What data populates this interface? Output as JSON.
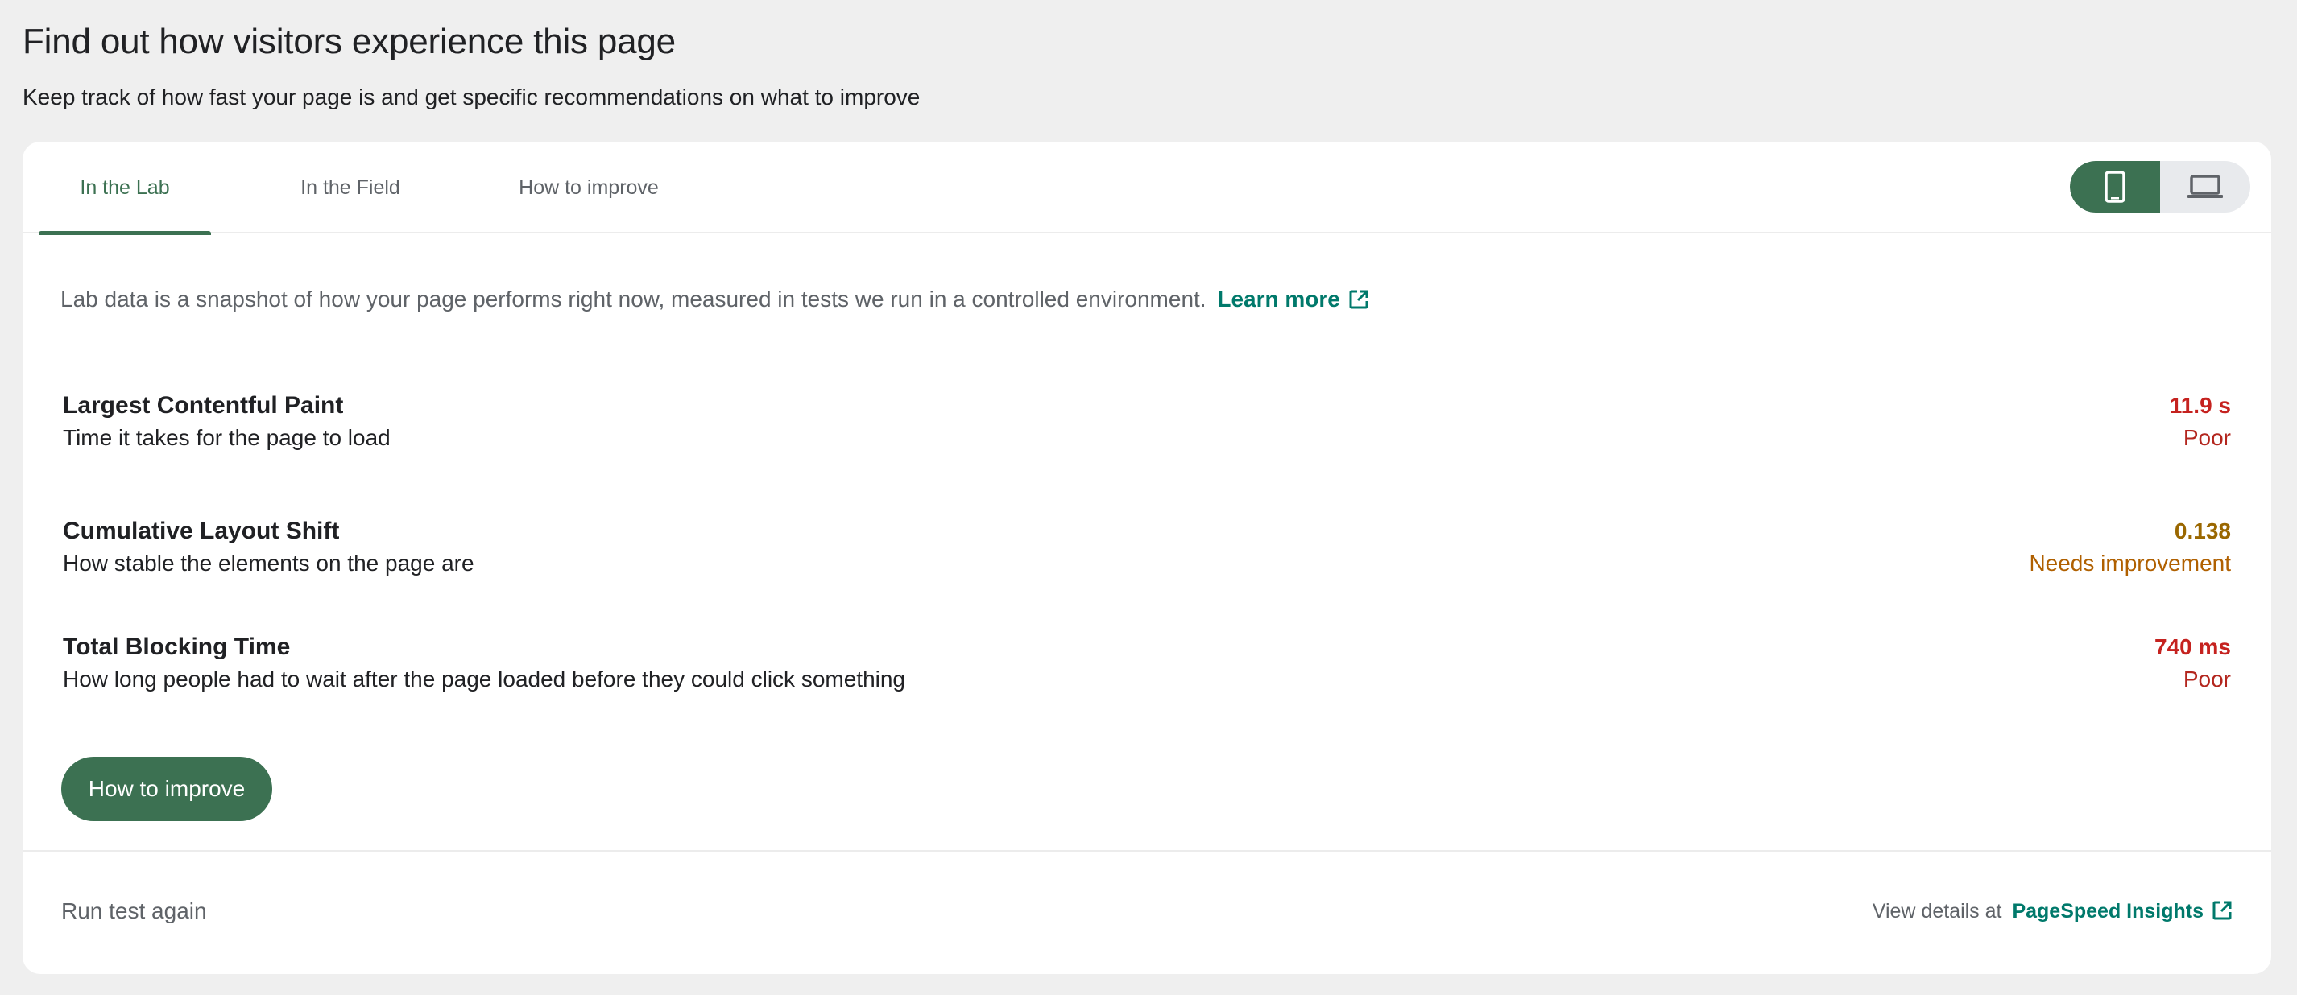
{
  "header": {
    "title": "Find out how visitors experience this page",
    "subtitle": "Keep track of how fast your page is and get specific recommendations on what to improve"
  },
  "tabs": {
    "lab": "In the Lab",
    "field": "In the Field",
    "improve": "How to improve",
    "active": "lab"
  },
  "device_toggle": {
    "selected": "mobile",
    "icons": [
      "phone-icon",
      "laptop-icon"
    ]
  },
  "intro": {
    "text": "Lab data is a snapshot of how your page performs right now, measured in tests we run in a controlled environment.",
    "learn_more": "Learn more"
  },
  "metrics": [
    {
      "name": "Largest Contentful Paint",
      "description": "Time it takes for the page to load",
      "value": "11.9 s",
      "rating": "Poor"
    },
    {
      "name": "Cumulative Layout Shift",
      "description": "How stable the elements on the page are",
      "value": "0.138",
      "rating": "Needs improvement"
    },
    {
      "name": "Total Blocking Time",
      "description": "How long people had to wait after the page loaded before they could click something",
      "value": "740 ms",
      "rating": "Poor"
    }
  ],
  "improve_button": "How to improve",
  "footer": {
    "run_again": "Run test again",
    "view_details_prefix": "View details at",
    "psi_link": "PageSpeed Insights"
  },
  "colors": {
    "accent_green": "#3c7152",
    "link_teal": "#00796b",
    "poor": "#c5221f",
    "needs_improvement": "#b06000"
  }
}
